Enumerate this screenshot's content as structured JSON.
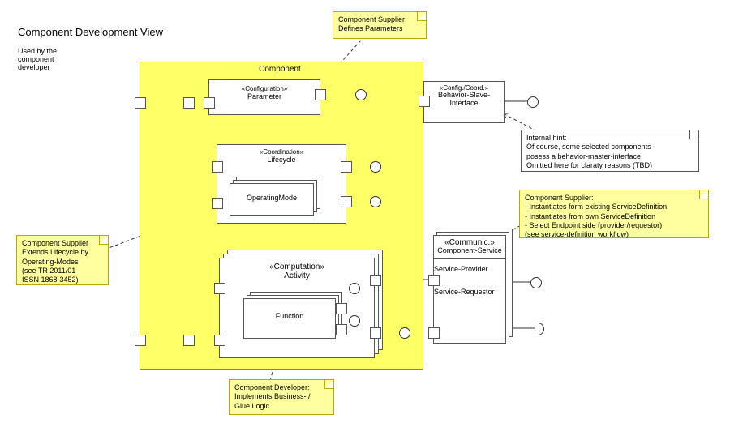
{
  "title": "Component Development View",
  "subtitle": "Used by the component developer",
  "component": {
    "label": "Component"
  },
  "elements": {
    "parameter": {
      "stereotype": "«Configuration»",
      "name": "Parameter"
    },
    "lifecycle": {
      "stereotype": "«Coordination»",
      "name": "Lifecycle"
    },
    "operatingMode": {
      "name": "OperatingMode"
    },
    "activity": {
      "stereotype": "«Computation»",
      "name": "Activity"
    },
    "function": {
      "name": "Function"
    },
    "behaviorInterface": {
      "stereotype": "«Config./Coord.»",
      "name": "Behavior-Slave-Interface"
    },
    "componentService": {
      "stereotype": "«Communic.»",
      "name": "Component-Service",
      "roles": {
        "provider": "Service-Provider",
        "dash": "-",
        "requestor": "Service-Requestor"
      }
    }
  },
  "notes": {
    "definesParams": "Component Supplier Defines Parameters",
    "extendsLifecycle": {
      "l1": "Component Supplier",
      "l2": "Extends Lifecycle by",
      "l3": "Operating-Modes",
      "l4": "(see TR 2011/01",
      "l5": "ISSN 1868-3452)"
    },
    "supplierService": {
      "l1": "Component Supplier:",
      "l2": "- Instantiates form existing ServiceDefinition",
      "l3": "- Instantiates from own ServiceDefinition",
      "l4": "- Select Endpoint side (provider/requestor)",
      "l5": "(see service-definition workflow)"
    },
    "developer": {
      "l1": "Component Developer:",
      "l2": "Implements Business- /",
      "l3": "Glue Logic"
    },
    "internal": {
      "l1": "Internal hint:",
      "l2": "Of course, some selected components",
      "l3": "posess a behavior-master-interface.",
      "l4": "Omitted here for claraty reasons (TBD)"
    }
  }
}
